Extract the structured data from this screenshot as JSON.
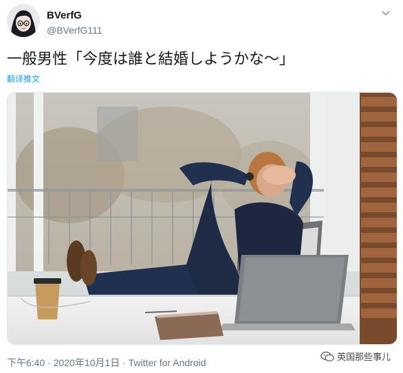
{
  "user": {
    "display_name": "BVerfG",
    "handle": "@BVerfG111",
    "avatar_icon": "anime-avatar-icon"
  },
  "tweet": {
    "text": "一般男性「今度は誰と結婚しようかな～」",
    "translate_label": "翻译推文",
    "media_alt_icon": "photo"
  },
  "meta": {
    "time": "下午6:40",
    "date": "2020年10月1日",
    "separator": "·",
    "source": "Twitter for Android"
  },
  "watermark": {
    "text": "英国那些事儿",
    "icon": "wechat-icon"
  },
  "colors": {
    "link": "#1da1f2",
    "muted": "#657786",
    "text": "#14171a"
  }
}
